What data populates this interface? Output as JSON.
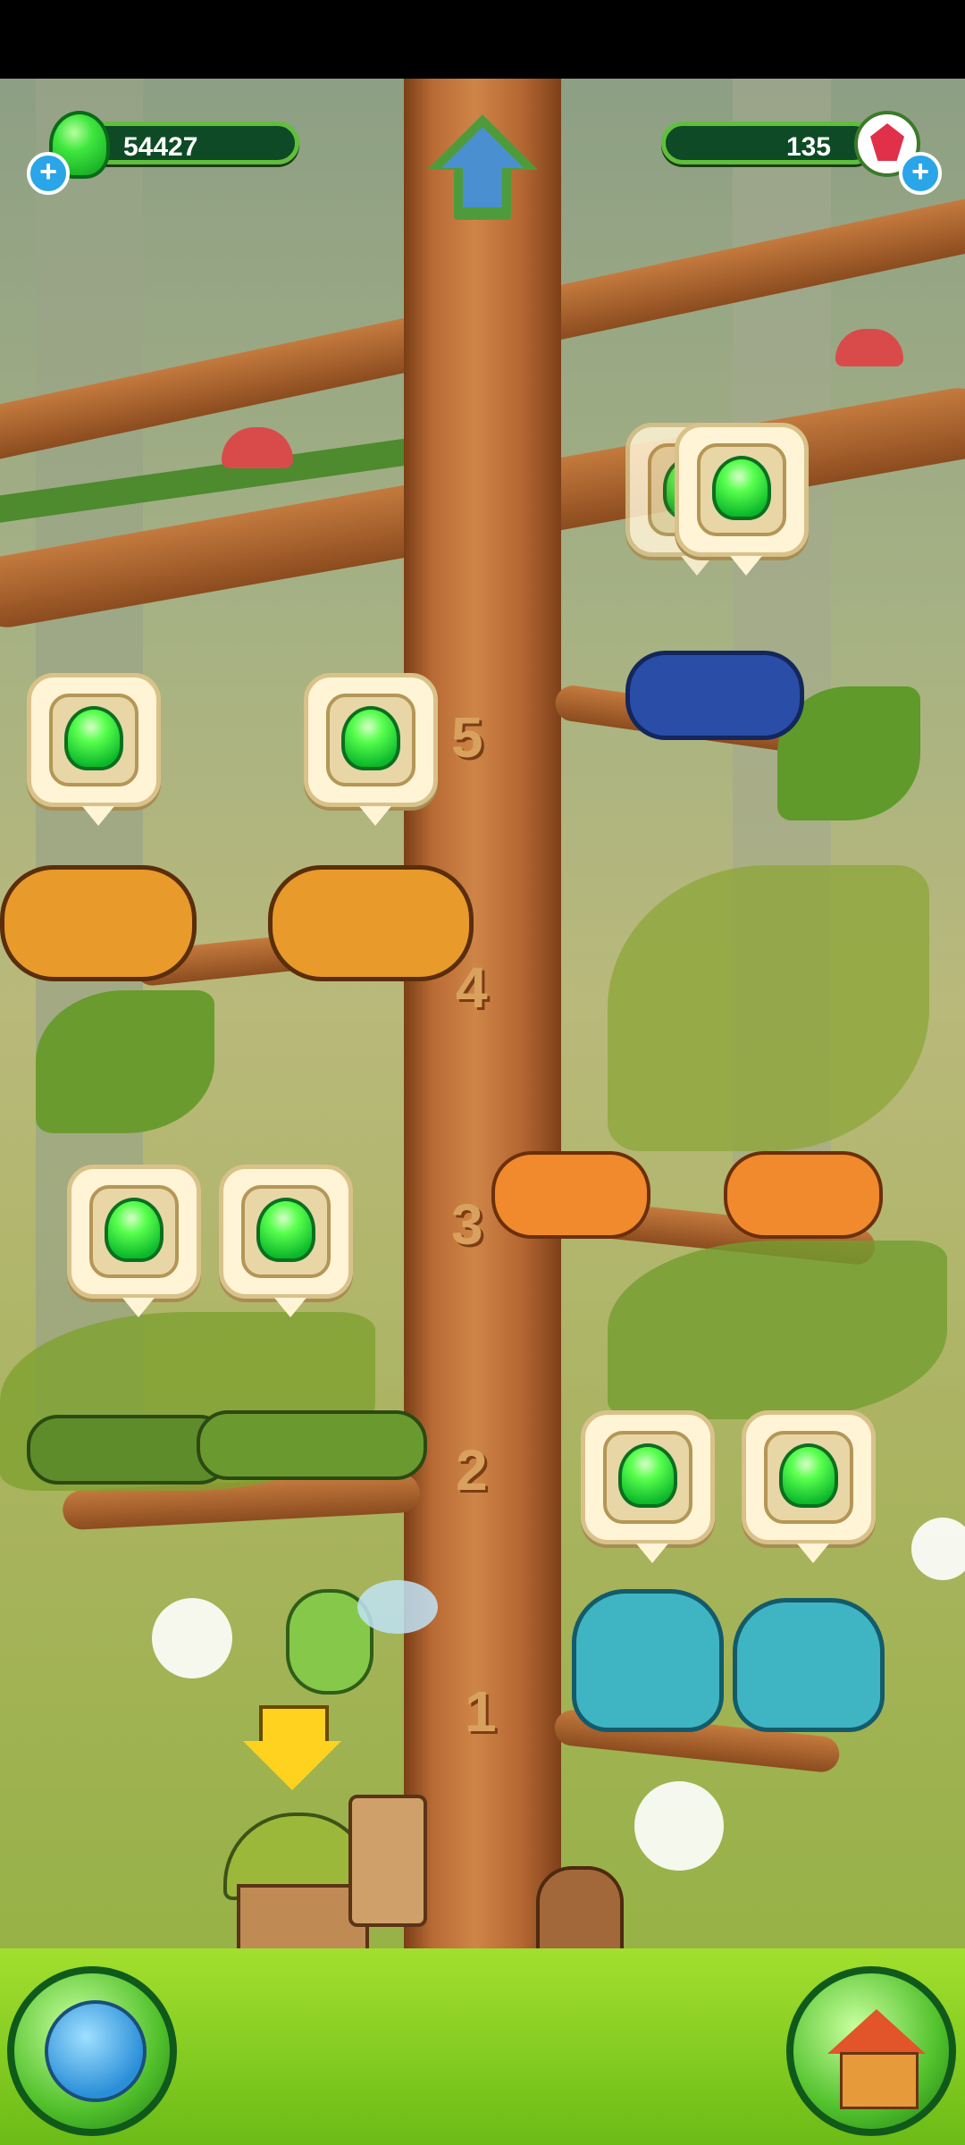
{
  "hud": {
    "gems_count": "54427",
    "rubies_count": "135"
  },
  "tree": {
    "levels": [
      "5",
      "4",
      "3",
      "2",
      "1"
    ]
  },
  "icons": {
    "home_arrow": "up-arrow-icon",
    "world": "globe-icon",
    "house": "house-icon",
    "hint": "down-arrow-icon"
  },
  "colors": {
    "gem_green": "#3ee63e",
    "ruby_red": "#e0304a",
    "plus_blue": "#2aa5e8",
    "hud_dark": "#0e4a25"
  }
}
